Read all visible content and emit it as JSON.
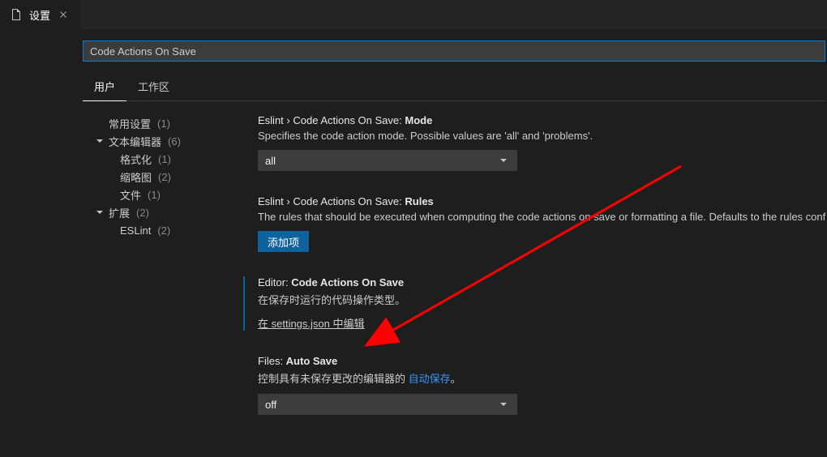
{
  "tab": {
    "title": "设置"
  },
  "search": {
    "value": "Code Actions On Save"
  },
  "scopes": {
    "user": "用户",
    "workspace": "工作区"
  },
  "sidebar": {
    "common": {
      "label": "常用设置",
      "count": "(1)"
    },
    "textEditor": {
      "label": "文本编辑器",
      "count": "(6)"
    },
    "formatting": {
      "label": "格式化",
      "count": "(1)"
    },
    "minimap": {
      "label": "缩略图",
      "count": "(2)"
    },
    "files": {
      "label": "文件",
      "count": "(1)"
    },
    "extensions": {
      "label": "扩展",
      "count": "(2)"
    },
    "eslint": {
      "label": "ESLint",
      "count": "(2)"
    }
  },
  "settings": {
    "eslintMode": {
      "scope": "Eslint › Code Actions On Save: ",
      "name": "Mode",
      "desc": "Specifies the code action mode. Possible values are 'all' and 'problems'.",
      "value": "all"
    },
    "eslintRules": {
      "scope": "Eslint › Code Actions On Save: ",
      "name": "Rules",
      "desc": "The rules that should be executed when computing the code actions on save or formatting a file. Defaults to the rules conf",
      "addBtn": "添加项"
    },
    "editorActions": {
      "scope": "Editor: ",
      "name": "Code Actions On Save",
      "desc": "在保存时运行的代码操作类型。",
      "editLink": "在 settings.json 中编辑"
    },
    "autoSave": {
      "scope": "Files: ",
      "name": "Auto Save",
      "descPre": "控制具有未保存更改的编辑器的 ",
      "descLink": "自动保存",
      "descPost": "。",
      "value": "off"
    }
  }
}
